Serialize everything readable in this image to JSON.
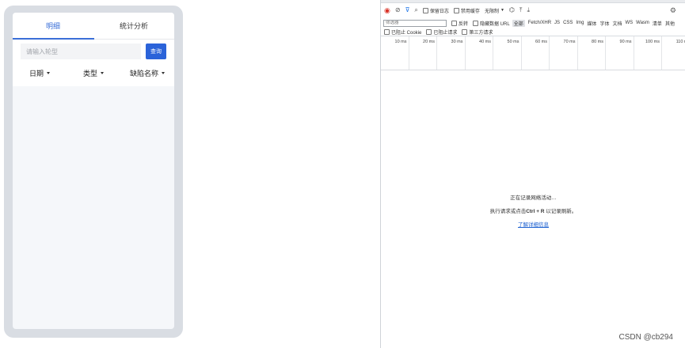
{
  "app": {
    "tabs": [
      {
        "label": "明细",
        "active": true
      },
      {
        "label": "统计分析",
        "active": false
      }
    ],
    "search": {
      "placeholder": "请输入轮型",
      "value": "",
      "button_label": "查询"
    },
    "filters": [
      {
        "label": "日期"
      },
      {
        "label": "类型"
      },
      {
        "label": "缺陷名称"
      }
    ]
  },
  "devtools": {
    "toolbar": {
      "preserve_log": "保留日志",
      "disable_cache": "禁用缓存",
      "throttle": "无限制"
    },
    "filter_bar": {
      "placeholder": "筛选器",
      "invert": "反转",
      "hide_data_urls": "隐藏数据 URL",
      "types": [
        "全部",
        "Fetch/XHR",
        "JS",
        "CSS",
        "Img",
        "媒体",
        "字体",
        "文档",
        "WS",
        "Wasm",
        "清单",
        "其他"
      ]
    },
    "cookie_bar": {
      "blocked_cookies": "已阻止 Cookie",
      "blocked_requests": "已阻止请求",
      "third_party": "第三方请求"
    },
    "timeline_ticks": [
      "10 ms",
      "20 ms",
      "30 ms",
      "40 ms",
      "50 ms",
      "60 ms",
      "70 ms",
      "80 ms",
      "90 ms",
      "100 ms",
      "110 m"
    ],
    "empty_state": {
      "line1": "正在记录网络活动…",
      "line2_prefix": "执行请求或点击",
      "line2_shortcut": "Ctrl + R",
      "line2_suffix": "以记录刷新。",
      "link": "了解详细信息"
    }
  },
  "watermark": "CSDN @cb294",
  "colors": {
    "accent": "#2b63d9",
    "tab_active": "#3a6fd8",
    "record": "#d93025",
    "link": "#1a5fd0"
  }
}
